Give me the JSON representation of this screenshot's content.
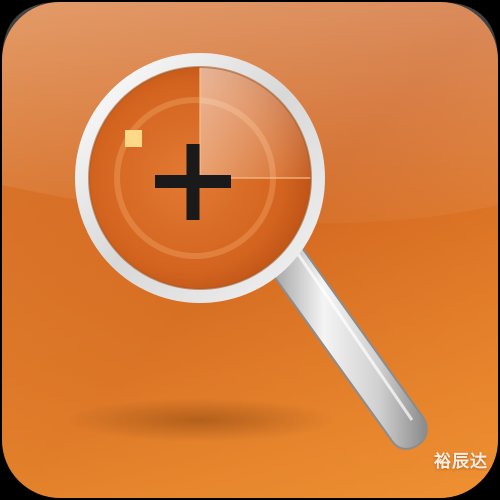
{
  "icon": {
    "name": "zoom-in-magnifier",
    "glyph": "plus",
    "colors": {
      "background_light": "#E8883A",
      "background_dark": "#C9561A",
      "lens_fill": "#D96A22",
      "rim": "#E6E6E6",
      "glyph": "#1A1A1A",
      "spark": "#FFD98A"
    }
  },
  "watermark": {
    "text": "裕辰达"
  }
}
